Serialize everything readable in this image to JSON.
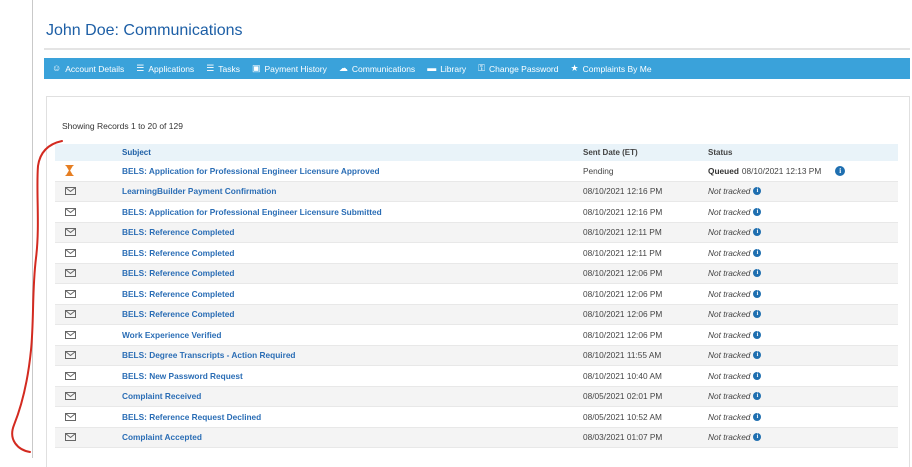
{
  "page": {
    "title": "John Doe: Communications"
  },
  "nav": [
    {
      "label": "Account Details",
      "icon": "user-icon"
    },
    {
      "label": "Applications",
      "icon": "list-icon"
    },
    {
      "label": "Tasks",
      "icon": "list-icon"
    },
    {
      "label": "Payment History",
      "icon": "money-icon"
    },
    {
      "label": "Communications",
      "icon": "cloud-icon"
    },
    {
      "label": "Library",
      "icon": "folder-icon"
    },
    {
      "label": "Change Password",
      "icon": "key-icon"
    },
    {
      "label": "Complaints By Me",
      "icon": "star-icon"
    }
  ],
  "records_label": "Showing Records 1 to 20 of 129",
  "table": {
    "headers": {
      "subject": "Subject",
      "sent_date": "Sent Date (ET)",
      "status": "Status"
    },
    "rows": [
      {
        "icon": "hourglass-icon",
        "subject": "BELS: Application for Professional Engineer Licensure Approved",
        "sent_date": "Pending",
        "status_bold": "Queued",
        "status": "08/10/2021 12:13 PM",
        "status_italic": false
      },
      {
        "icon": "envelope-icon",
        "subject": "LearningBuilder Payment Confirmation",
        "sent_date": "08/10/2021 12:16 PM",
        "status_bold": "",
        "status": "Not tracked",
        "status_italic": true
      },
      {
        "icon": "envelope-icon",
        "subject": "BELS: Application for Professional Engineer Licensure Submitted",
        "sent_date": "08/10/2021 12:16 PM",
        "status_bold": "",
        "status": "Not tracked",
        "status_italic": true
      },
      {
        "icon": "envelope-icon",
        "subject": "BELS: Reference Completed",
        "sent_date": "08/10/2021 12:11 PM",
        "status_bold": "",
        "status": "Not tracked",
        "status_italic": true
      },
      {
        "icon": "envelope-icon",
        "subject": "BELS: Reference Completed",
        "sent_date": "08/10/2021 12:11 PM",
        "status_bold": "",
        "status": "Not tracked",
        "status_italic": true
      },
      {
        "icon": "envelope-icon",
        "subject": "BELS: Reference Completed",
        "sent_date": "08/10/2021 12:06 PM",
        "status_bold": "",
        "status": "Not tracked",
        "status_italic": true
      },
      {
        "icon": "envelope-icon",
        "subject": "BELS: Reference Completed",
        "sent_date": "08/10/2021 12:06 PM",
        "status_bold": "",
        "status": "Not tracked",
        "status_italic": true
      },
      {
        "icon": "envelope-icon",
        "subject": "BELS: Reference Completed",
        "sent_date": "08/10/2021 12:06 PM",
        "status_bold": "",
        "status": "Not tracked",
        "status_italic": true
      },
      {
        "icon": "envelope-icon",
        "subject": "Work Experience Verified",
        "sent_date": "08/10/2021 12:06 PM",
        "status_bold": "",
        "status": "Not tracked",
        "status_italic": true
      },
      {
        "icon": "envelope-icon",
        "subject": "BELS: Degree Transcripts - Action Required",
        "sent_date": "08/10/2021 11:55 AM",
        "status_bold": "",
        "status": "Not tracked",
        "status_italic": true
      },
      {
        "icon": "envelope-icon",
        "subject": "BELS: New Password Request",
        "sent_date": "08/10/2021 10:40 AM",
        "status_bold": "",
        "status": "Not tracked",
        "status_italic": true
      },
      {
        "icon": "envelope-icon",
        "subject": "Complaint Received",
        "sent_date": "08/05/2021 02:01 PM",
        "status_bold": "",
        "status": "Not tracked",
        "status_italic": true
      },
      {
        "icon": "envelope-icon",
        "subject": "BELS: Reference Request Declined",
        "sent_date": "08/05/2021 10:52 AM",
        "status_bold": "",
        "status": "Not tracked",
        "status_italic": true
      },
      {
        "icon": "envelope-icon",
        "subject": "Complaint Accepted",
        "sent_date": "08/03/2021 01:07 PM",
        "status_bold": "",
        "status": "Not tracked",
        "status_italic": true
      }
    ]
  },
  "colors": {
    "nav_bg": "#3aa2da",
    "link": "#2a6db5",
    "header_bg": "#e9f3f9",
    "annotation": "#d32a20",
    "hourglass": "#e67e22"
  }
}
